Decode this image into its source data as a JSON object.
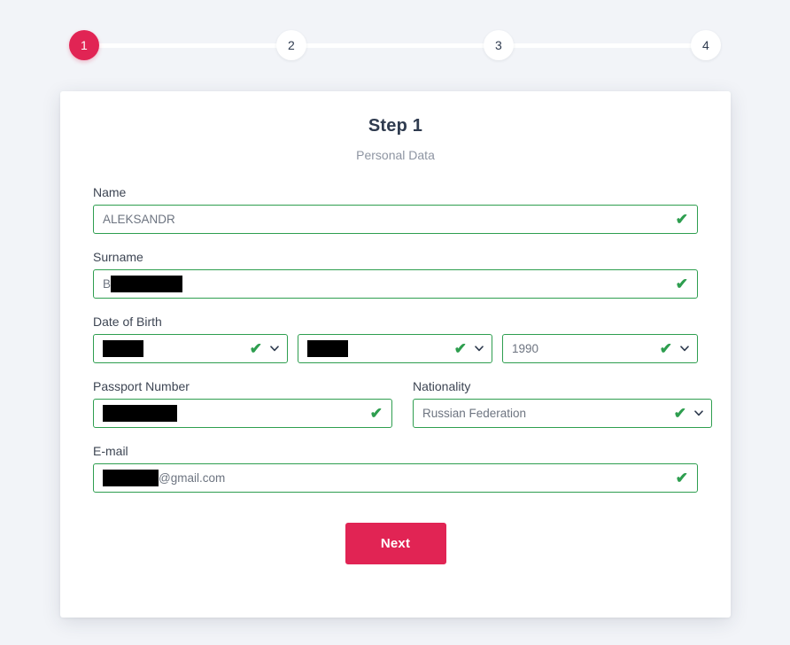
{
  "stepper": {
    "steps": [
      {
        "label": "1",
        "state": "active"
      },
      {
        "label": "2",
        "state": "inactive"
      },
      {
        "label": "3",
        "state": "inactive"
      },
      {
        "label": "4",
        "state": "inactive"
      }
    ]
  },
  "card": {
    "title": "Step 1",
    "subtitle": "Personal Data"
  },
  "form": {
    "name": {
      "label": "Name",
      "value": "ALEKSANDR",
      "valid_icon": "check-icon"
    },
    "surname": {
      "label": "Surname",
      "value": "B",
      "redacted": true,
      "valid_icon": "check-icon"
    },
    "date_of_birth": {
      "label": "Date of Birth",
      "day": {
        "value": "",
        "redacted": true,
        "valid_icon": "check-icon",
        "caret_icon": "chevron-down-icon"
      },
      "month": {
        "value": "",
        "redacted": true,
        "valid_icon": "check-icon",
        "caret_icon": "chevron-down-icon"
      },
      "year": {
        "value": "1990",
        "redacted": false,
        "valid_icon": "check-icon",
        "caret_icon": "chevron-down-icon"
      }
    },
    "passport_number": {
      "label": "Passport Number",
      "value": "",
      "redacted": true,
      "valid_icon": "check-icon"
    },
    "nationality": {
      "label": "Nationality",
      "value": "Russian Federation",
      "valid_icon": "check-icon",
      "caret_icon": "chevron-down-icon"
    },
    "email": {
      "label": "E-mail",
      "value_suffix": "@gmail.com",
      "redacted": true,
      "valid_icon": "check-icon"
    }
  },
  "actions": {
    "next_label": "Next"
  },
  "colors": {
    "accent": "#e12454",
    "valid_border": "#2e9e4f",
    "page_bg": "#f2f4f8",
    "card_bg": "#ffffff",
    "title": "#2f3b4f",
    "subtitle": "#8e95a2"
  },
  "icons": {
    "check": "✔"
  }
}
